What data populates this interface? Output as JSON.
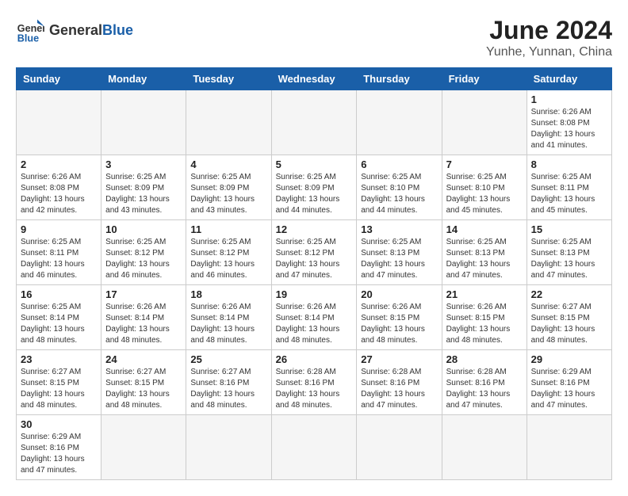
{
  "header": {
    "logo_general": "General",
    "logo_blue": "Blue",
    "title": "June 2024",
    "subtitle": "Yunhe, Yunnan, China"
  },
  "weekdays": [
    "Sunday",
    "Monday",
    "Tuesday",
    "Wednesday",
    "Thursday",
    "Friday",
    "Saturday"
  ],
  "weeks": [
    [
      {
        "day": "",
        "info": ""
      },
      {
        "day": "",
        "info": ""
      },
      {
        "day": "",
        "info": ""
      },
      {
        "day": "",
        "info": ""
      },
      {
        "day": "",
        "info": ""
      },
      {
        "day": "",
        "info": ""
      },
      {
        "day": "1",
        "info": "Sunrise: 6:26 AM\nSunset: 8:08 PM\nDaylight: 13 hours and 41 minutes."
      }
    ],
    [
      {
        "day": "2",
        "info": "Sunrise: 6:26 AM\nSunset: 8:08 PM\nDaylight: 13 hours and 42 minutes."
      },
      {
        "day": "3",
        "info": "Sunrise: 6:25 AM\nSunset: 8:09 PM\nDaylight: 13 hours and 43 minutes."
      },
      {
        "day": "4",
        "info": "Sunrise: 6:25 AM\nSunset: 8:09 PM\nDaylight: 13 hours and 43 minutes."
      },
      {
        "day": "5",
        "info": "Sunrise: 6:25 AM\nSunset: 8:09 PM\nDaylight: 13 hours and 44 minutes."
      },
      {
        "day": "6",
        "info": "Sunrise: 6:25 AM\nSunset: 8:10 PM\nDaylight: 13 hours and 44 minutes."
      },
      {
        "day": "7",
        "info": "Sunrise: 6:25 AM\nSunset: 8:10 PM\nDaylight: 13 hours and 45 minutes."
      },
      {
        "day": "8",
        "info": "Sunrise: 6:25 AM\nSunset: 8:11 PM\nDaylight: 13 hours and 45 minutes."
      }
    ],
    [
      {
        "day": "9",
        "info": "Sunrise: 6:25 AM\nSunset: 8:11 PM\nDaylight: 13 hours and 46 minutes."
      },
      {
        "day": "10",
        "info": "Sunrise: 6:25 AM\nSunset: 8:12 PM\nDaylight: 13 hours and 46 minutes."
      },
      {
        "day": "11",
        "info": "Sunrise: 6:25 AM\nSunset: 8:12 PM\nDaylight: 13 hours and 46 minutes."
      },
      {
        "day": "12",
        "info": "Sunrise: 6:25 AM\nSunset: 8:12 PM\nDaylight: 13 hours and 47 minutes."
      },
      {
        "day": "13",
        "info": "Sunrise: 6:25 AM\nSunset: 8:13 PM\nDaylight: 13 hours and 47 minutes."
      },
      {
        "day": "14",
        "info": "Sunrise: 6:25 AM\nSunset: 8:13 PM\nDaylight: 13 hours and 47 minutes."
      },
      {
        "day": "15",
        "info": "Sunrise: 6:25 AM\nSunset: 8:13 PM\nDaylight: 13 hours and 47 minutes."
      }
    ],
    [
      {
        "day": "16",
        "info": "Sunrise: 6:25 AM\nSunset: 8:14 PM\nDaylight: 13 hours and 48 minutes."
      },
      {
        "day": "17",
        "info": "Sunrise: 6:26 AM\nSunset: 8:14 PM\nDaylight: 13 hours and 48 minutes."
      },
      {
        "day": "18",
        "info": "Sunrise: 6:26 AM\nSunset: 8:14 PM\nDaylight: 13 hours and 48 minutes."
      },
      {
        "day": "19",
        "info": "Sunrise: 6:26 AM\nSunset: 8:14 PM\nDaylight: 13 hours and 48 minutes."
      },
      {
        "day": "20",
        "info": "Sunrise: 6:26 AM\nSunset: 8:15 PM\nDaylight: 13 hours and 48 minutes."
      },
      {
        "day": "21",
        "info": "Sunrise: 6:26 AM\nSunset: 8:15 PM\nDaylight: 13 hours and 48 minutes."
      },
      {
        "day": "22",
        "info": "Sunrise: 6:27 AM\nSunset: 8:15 PM\nDaylight: 13 hours and 48 minutes."
      }
    ],
    [
      {
        "day": "23",
        "info": "Sunrise: 6:27 AM\nSunset: 8:15 PM\nDaylight: 13 hours and 48 minutes."
      },
      {
        "day": "24",
        "info": "Sunrise: 6:27 AM\nSunset: 8:15 PM\nDaylight: 13 hours and 48 minutes."
      },
      {
        "day": "25",
        "info": "Sunrise: 6:27 AM\nSunset: 8:16 PM\nDaylight: 13 hours and 48 minutes."
      },
      {
        "day": "26",
        "info": "Sunrise: 6:28 AM\nSunset: 8:16 PM\nDaylight: 13 hours and 48 minutes."
      },
      {
        "day": "27",
        "info": "Sunrise: 6:28 AM\nSunset: 8:16 PM\nDaylight: 13 hours and 47 minutes."
      },
      {
        "day": "28",
        "info": "Sunrise: 6:28 AM\nSunset: 8:16 PM\nDaylight: 13 hours and 47 minutes."
      },
      {
        "day": "29",
        "info": "Sunrise: 6:29 AM\nSunset: 8:16 PM\nDaylight: 13 hours and 47 minutes."
      }
    ],
    [
      {
        "day": "30",
        "info": "Sunrise: 6:29 AM\nSunset: 8:16 PM\nDaylight: 13 hours and 47 minutes."
      },
      {
        "day": "",
        "info": ""
      },
      {
        "day": "",
        "info": ""
      },
      {
        "day": "",
        "info": ""
      },
      {
        "day": "",
        "info": ""
      },
      {
        "day": "",
        "info": ""
      },
      {
        "day": "",
        "info": ""
      }
    ]
  ]
}
